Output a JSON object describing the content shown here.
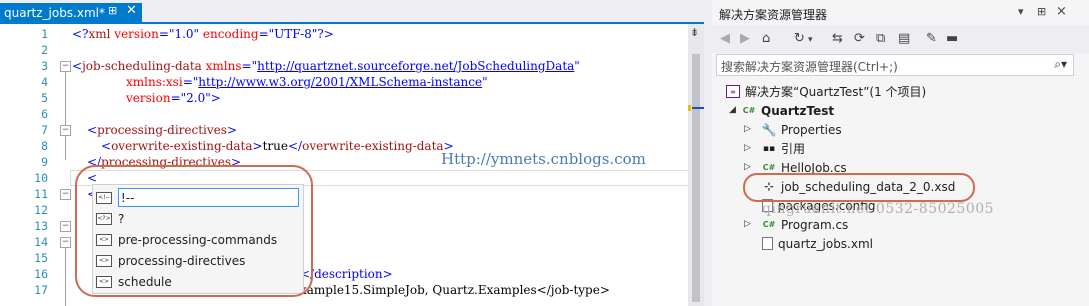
{
  "editor": {
    "tab_title": "quartz_jobs.xml*",
    "tab_pin": "⊞",
    "tab_close": "✕",
    "line_numbers": [
      "1",
      "2",
      "3",
      "4",
      "5",
      "6",
      "7",
      "8",
      "9",
      "10",
      "11",
      "12",
      "13",
      "14",
      "15",
      "16",
      "17"
    ],
    "line1_a": "<?",
    "line1_b": "xml",
    "line1_c": " version",
    "line1_d": "=",
    "line1_e": "\"1.0\"",
    "line1_f": " encoding",
    "line1_g": "=",
    "line1_h": "\"UTF-8\"",
    "line1_i": "?>",
    "line3_tag": "job-scheduling-data",
    "line3_attr": " xmlns",
    "line3_url": "http://quartznet.sourceforge.net/JobSchedulingData",
    "line4_attr": "xmlns:xsi",
    "line4_url": "http://www.w3.org/2001/XMLSchema-instance",
    "line5_attr": "version",
    "line5_val": "\"2.0\"",
    "line7_tag": "processing-directives",
    "line8_tag": "overwrite-existing-data",
    "line8_text": "true",
    "line8_close": "overwrite-existing-data",
    "line9_tag": "processing-directives",
    "line10_text": "<",
    "line11_text": "<",
    "line16_tail": "</description>",
    "line17_tail": "xample15.SimpleJob, Quartz.Examples</job-type>",
    "watermark": "Http://ymnets.cnblogs.com"
  },
  "completion": {
    "items": [
      {
        "label": "!--",
        "icon": "<!--"
      },
      {
        "label": "?",
        "icon": "<?>"
      },
      {
        "label": "pre-processing-commands",
        "icon": "<>"
      },
      {
        "label": "processing-directives",
        "icon": "<>"
      },
      {
        "label": "schedule",
        "icon": "<>"
      }
    ]
  },
  "solution_explorer": {
    "title": "解决方案资源管理器",
    "search_placeholder": "搜索解决方案资源管理器(Ctrl+;)",
    "solution_label": "解决方案“QuartzTest”(1 个项目)",
    "project": "QuartzTest",
    "items": [
      {
        "label": "Properties",
        "icon": "wrench-icon"
      },
      {
        "label": "引用",
        "icon": "references-icon"
      },
      {
        "label": "HelloJob.cs",
        "icon": "csharp-icon"
      },
      {
        "label": "job_scheduling_data_2_0.xsd",
        "icon": "xsd-icon"
      },
      {
        "label": "packages.config",
        "icon": "config-file-icon"
      },
      {
        "label": "Program.cs",
        "icon": "csharp-icon"
      },
      {
        "label": "quartz_jobs.xml",
        "icon": "xml-file-icon"
      }
    ],
    "watermark": "qingruanit.net 0532-85025005"
  }
}
